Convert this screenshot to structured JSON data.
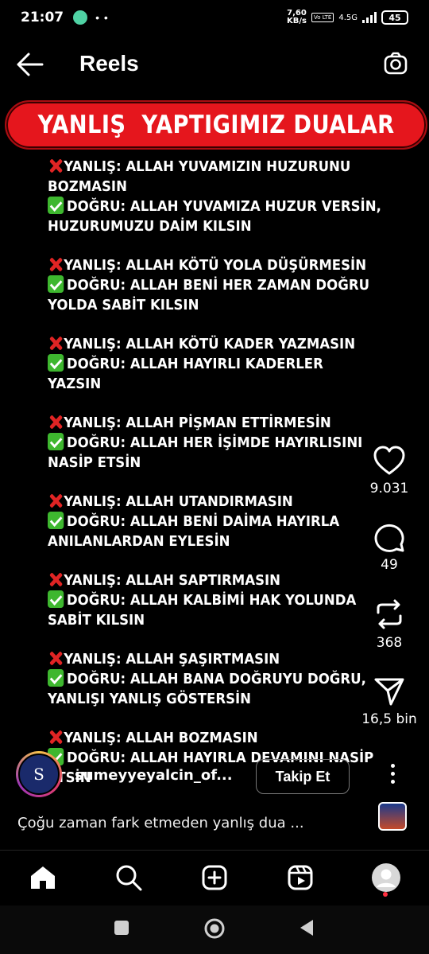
{
  "status_bar": {
    "time": "21:07",
    "dots": "• •",
    "speed_value": "7,60",
    "speed_unit": "KB/s",
    "volte_label": "Vo LTE",
    "network": "4.5G",
    "battery": "45"
  },
  "header": {
    "title": "Reels"
  },
  "post": {
    "banner_title": "YANLIŞ  YAPTIGIMIZ DUALAR",
    "blocks": [
      {
        "wrong": [
          "YANLIŞ: ALLAH YUVAMIZIN HUZURUNU",
          "BOZMASIN"
        ],
        "right": [
          "DOĞRU: ALLAH YUVAMIZA HUZUR VERSİN,",
          "HUZURUMUZU DAİM KILSIN"
        ]
      },
      {
        "wrong": [
          "YANLIŞ: ALLAH KÖTÜ YOLA DÜŞÜRMESİN"
        ],
        "right": [
          "DOĞRU: ALLAH BENİ HER ZAMAN DOĞRU",
          "YOLDA SABİT KILSIN"
        ]
      },
      {
        "wrong": [
          "YANLIŞ: ALLAH KÖTÜ KADER YAZMASIN"
        ],
        "right": [
          "DOĞRU: ALLAH HAYIRLI KADERLER",
          "YAZSIN"
        ]
      },
      {
        "wrong": [
          "YANLIŞ: ALLAH PİŞMAN ETTİRMESİN"
        ],
        "right": [
          "DOĞRU: ALLAH HER İŞİMDE HAYIRLISINI",
          "NASİP ETSİN"
        ]
      },
      {
        "wrong": [
          "YANLIŞ: ALLAH UTANDIRMASIN"
        ],
        "right": [
          "DOĞRU: ALLAH BENİ DAİMA HAYIRLA",
          "ANILANLARDAN EYLESİN"
        ]
      },
      {
        "wrong": [
          "YANLIŞ: ALLAH SAPTIRMASIN"
        ],
        "right": [
          "DOĞRU: ALLAH KALBİMİ HAK YOLUNDA",
          "SABİT KILSIN"
        ]
      },
      {
        "wrong": [
          "YANLIŞ: ALLAH ŞAŞIRTMASIN"
        ],
        "right": [
          "DOĞRU: ALLAH BANA DOĞRUYU DOĞRU,",
          "YANLIŞI YANLIŞ GÖSTERSİN"
        ]
      },
      {
        "wrong": [
          "YANLIŞ: ALLAH BOZMASIN"
        ],
        "right": [
          "DOĞRU: ALLAH HAYIRLA DEVAMINI NASİP",
          "ETSİN"
        ]
      }
    ]
  },
  "actions": {
    "likes": "9.031",
    "comments": "49",
    "reposts": "368",
    "shares": "16,5 bin"
  },
  "author": {
    "username": "sumeyyeyalcin_of...",
    "avatar_letter": "S",
    "follow_label": "Takip Et"
  },
  "caption": "Çoğu zaman fark etmeden yanlış dua ...",
  "colors": {
    "banner": "#e5161d",
    "wrong_mark": "#e02424",
    "right_mark": "#3eb72f",
    "notification_dot": "#ff3040"
  },
  "icons": {
    "back": "arrow-left-icon",
    "camera": "camera-icon",
    "like": "heart-icon",
    "comment": "comment-bubble-icon",
    "repost": "repost-icon",
    "share": "send-icon",
    "more": "more-vertical-icon",
    "nav": [
      "home-icon",
      "search-icon",
      "create-icon",
      "reels-icon",
      "profile-icon"
    ],
    "system": [
      "recents-icon",
      "home-circle-icon",
      "back-triangle-icon"
    ]
  }
}
